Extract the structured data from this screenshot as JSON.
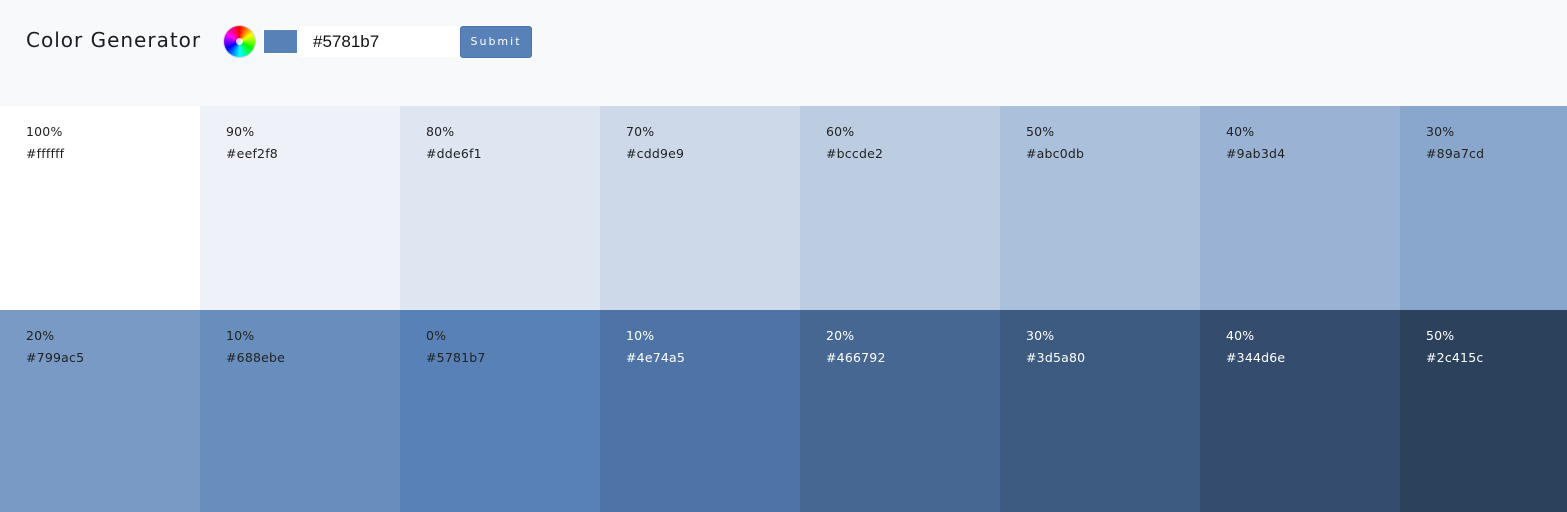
{
  "header": {
    "title": "Color Generator",
    "selected_color": "#5781b7",
    "hex_value": "#5781b7",
    "submit_label": "Submit",
    "accent": "#5781b7"
  },
  "palette": {
    "tints": [
      {
        "percent": "100%",
        "hex": "#ffffff",
        "text_color": "#222222"
      },
      {
        "percent": "90%",
        "hex": "#eef2f8",
        "text_color": "#222222"
      },
      {
        "percent": "80%",
        "hex": "#dde6f1",
        "text_color": "#222222"
      },
      {
        "percent": "70%",
        "hex": "#cdd9e9",
        "text_color": "#222222"
      },
      {
        "percent": "60%",
        "hex": "#bccde2",
        "text_color": "#222222"
      },
      {
        "percent": "50%",
        "hex": "#abc0db",
        "text_color": "#222222"
      },
      {
        "percent": "40%",
        "hex": "#9ab3d4",
        "text_color": "#222222"
      },
      {
        "percent": "30%",
        "hex": "#89a7cd",
        "text_color": "#222222"
      }
    ],
    "shades": [
      {
        "percent": "20%",
        "hex": "#799ac5",
        "text_color": "#222222"
      },
      {
        "percent": "10%",
        "hex": "#688ebe",
        "text_color": "#222222"
      },
      {
        "percent": "0%",
        "hex": "#5781b7",
        "text_color": "#222222"
      },
      {
        "percent": "10%",
        "hex": "#4e74a5",
        "text_color": "#ffffff"
      },
      {
        "percent": "20%",
        "hex": "#466792",
        "text_color": "#ffffff"
      },
      {
        "percent": "30%",
        "hex": "#3d5a80",
        "text_color": "#ffffff"
      },
      {
        "percent": "40%",
        "hex": "#344d6e",
        "text_color": "#ffffff"
      },
      {
        "percent": "50%",
        "hex": "#2c415c",
        "text_color": "#ffffff"
      }
    ]
  }
}
